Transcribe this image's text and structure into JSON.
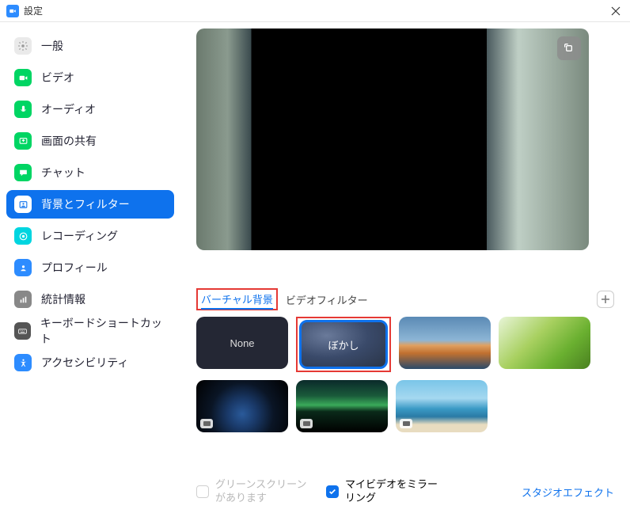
{
  "titlebar": {
    "title": "設定"
  },
  "sidebar": {
    "items": [
      {
        "label": "一般",
        "icon": "gear",
        "color": "#d8d8d8"
      },
      {
        "label": "ビデオ",
        "icon": "video",
        "color": "#00d563"
      },
      {
        "label": "オーディオ",
        "icon": "audio",
        "color": "#00d563"
      },
      {
        "label": "画面の共有",
        "icon": "share",
        "color": "#00d563"
      },
      {
        "label": "チャット",
        "icon": "chat",
        "color": "#00d563"
      },
      {
        "label": "背景とフィルター",
        "icon": "background",
        "color": "#ffffff",
        "selected": true
      },
      {
        "label": "レコーディング",
        "icon": "record",
        "color": "#00d5e0"
      },
      {
        "label": "プロフィール",
        "icon": "profile",
        "color": "#2d8cff"
      },
      {
        "label": "統計情報",
        "icon": "stats",
        "color": "#888888"
      },
      {
        "label": "キーボードショートカット",
        "icon": "keyboard",
        "color": "#555555"
      },
      {
        "label": "アクセシビリティ",
        "icon": "accessibility",
        "color": "#2d8cff"
      }
    ]
  },
  "tabs": {
    "virtual_background": "バーチャル背景",
    "video_filter": "ビデオフィルター"
  },
  "thumbs": {
    "none": "None",
    "blur": "ぼかし"
  },
  "options": {
    "green_screen": "グリーンスクリーンがあります",
    "mirror": "マイビデオをミラーリング",
    "studio_effects": "スタジオエフェクト"
  }
}
